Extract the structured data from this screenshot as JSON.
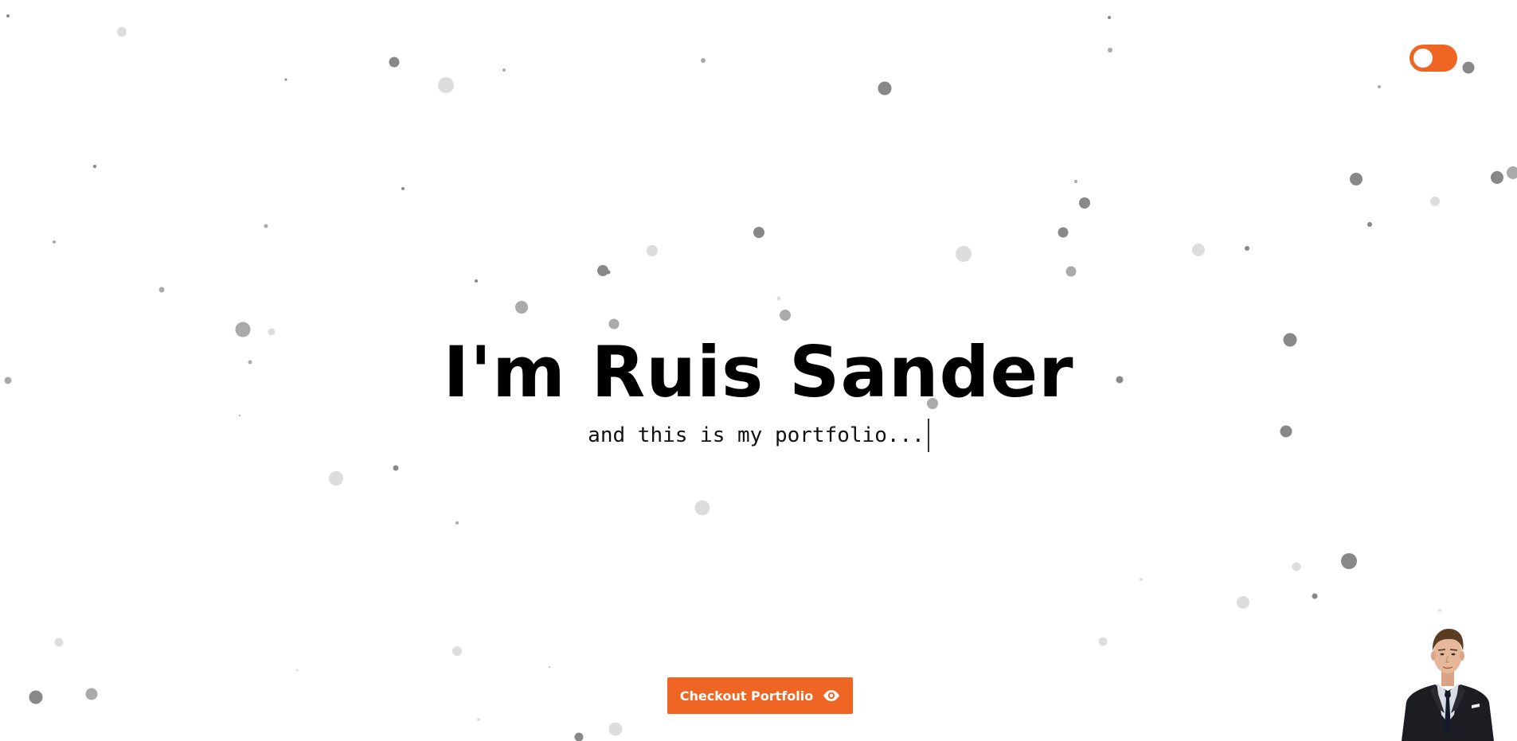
{
  "hero": {
    "title": "I'm Ruis Sander",
    "subtitle": "and this is my portfolio..."
  },
  "theme_toggle": {
    "state": "on",
    "icon": "toggle-switch-icon"
  },
  "cta": {
    "label": "Checkout Portfolio",
    "icon": "eye-icon"
  },
  "avatar": {
    "icon": "profile-photo"
  },
  "colors": {
    "accent": "#EE6524",
    "text": "#000000",
    "particle_dark": "#888888",
    "particle_mid": "#aaaaaa",
    "particle_light": "#dddddd",
    "suit": "#1c1d22",
    "shirt": "#d9dde6",
    "skin": "#e6b89a",
    "hair": "#5a3c22"
  }
}
